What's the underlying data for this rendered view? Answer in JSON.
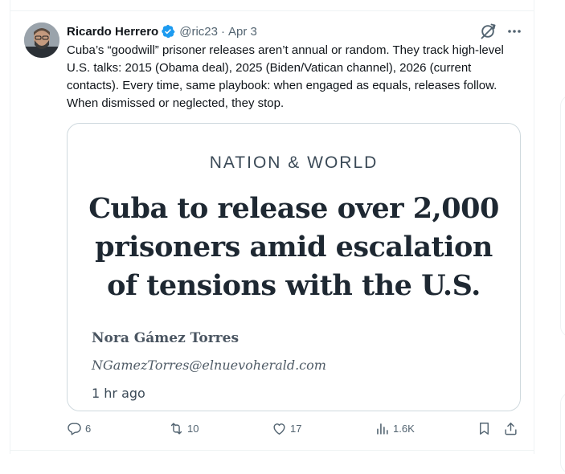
{
  "tweet": {
    "author_name": "Ricardo Herrero",
    "handle": "@ric23",
    "separator": "·",
    "date": "Apr 3",
    "text": "Cuba’s “goodwill” prisoner releases aren’t annual or random. They track high-level U.S. talks: 2015 (Obama deal), 2025 (Biden/Vatican channel), 2026 (current contacts). Every time, same playbook: when engaged as equals, releases follow. When dismissed or neglected, they stop."
  },
  "card": {
    "kicker": "NATION & WORLD",
    "headline": "Cuba to release over 2,000 prisoners amid escalation of tensions with the U.S.",
    "byline": "Nora Gámez Torres",
    "email": "NGamezTorres@elnuevoherald.com",
    "time_ago": "1 hr ago"
  },
  "actions": {
    "replies": "6",
    "reposts": "10",
    "likes": "17",
    "views": "1.6K"
  },
  "colors": {
    "verified": "#1d9bf0",
    "muted": "#536471",
    "border": "#cfd9de"
  }
}
